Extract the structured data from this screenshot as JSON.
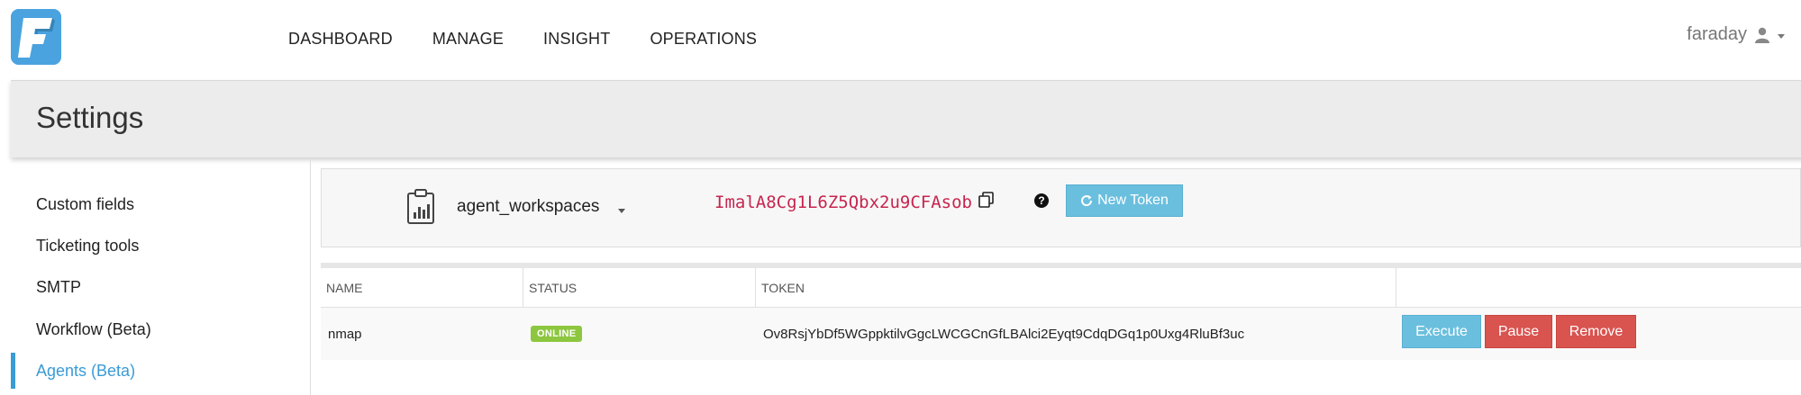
{
  "nav": {
    "items": [
      "DASHBOARD",
      "MANAGE",
      "INSIGHT",
      "OPERATIONS"
    ],
    "user": "faraday"
  },
  "page": {
    "title": "Settings"
  },
  "sidebar": {
    "items": [
      {
        "label": "Custom fields",
        "active": false
      },
      {
        "label": "Ticketing tools",
        "active": false
      },
      {
        "label": "SMTP",
        "active": false
      },
      {
        "label": "Workflow (Beta)",
        "active": false
      },
      {
        "label": "Agents (Beta)",
        "active": true
      }
    ]
  },
  "agent_bar": {
    "workspace": "agent_workspaces",
    "registration_token": "ImalA8Cg1L6Z5Qbx2u9CFAsob",
    "new_token_label": "New Token"
  },
  "table": {
    "headers": [
      "NAME",
      "STATUS",
      "TOKEN",
      ""
    ],
    "rows": [
      {
        "name": "nmap",
        "status": "ONLINE",
        "token": "Ov8RsjYbDf5WGppktilvGgcLWCGCnGfLBAlci2Eyqt9CdqDGq1p0Uxg4RluBf3uc"
      }
    ],
    "actions": {
      "execute": "Execute",
      "pause": "Pause",
      "remove": "Remove"
    }
  },
  "colors": {
    "accent": "#3a9bd5",
    "info_button": "#6bbfde",
    "danger_button": "#d9534f",
    "online_badge": "#8dc63f",
    "token_text": "#c7254e"
  }
}
